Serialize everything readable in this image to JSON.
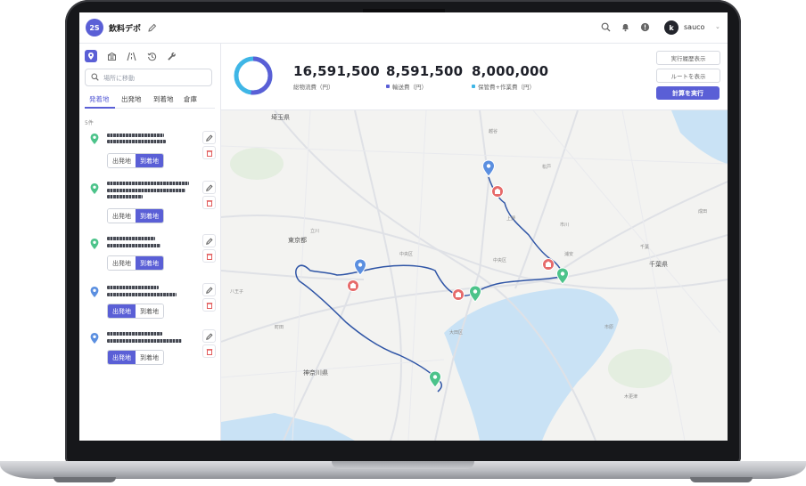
{
  "workspace": {
    "initials": "2S",
    "name": "飲料デポ"
  },
  "user": {
    "initial": "k",
    "name": "sauco"
  },
  "sidebar": {
    "search_placeholder": "場所に移動",
    "tabs": [
      "発着地",
      "出発地",
      "到着地",
      "倉庫"
    ],
    "active_tab": "発着地",
    "count": "5件",
    "locations": [
      {
        "pin_color": "#4cc38a",
        "mode": "到着地"
      },
      {
        "pin_color": "#4cc38a",
        "mode": "到着地"
      },
      {
        "pin_color": "#4cc38a",
        "mode": "到着地"
      },
      {
        "pin_color": "#5b8fe0",
        "mode": "出発地"
      },
      {
        "pin_color": "#5b8fe0",
        "mode": "出発地"
      }
    ],
    "mode_labels": {
      "departure": "出発地",
      "arrival": "到着地"
    }
  },
  "summary": {
    "total_value": "16,591,500",
    "total_label": "総物流費（円）",
    "transport_value": "8,591,500",
    "transport_label": "輸送費（円）",
    "storage_value": "8,000,000",
    "storage_label": "保管費+作業費（円）",
    "donut_split": 0.52,
    "colors": {
      "transport": "#5a5fd6",
      "storage": "#3fb6e6",
      "accent": "#5a5fd6"
    }
  },
  "actions": {
    "history_label": "実行履歴表示",
    "route_label": "ルートを表示",
    "run_label": "計算を実行"
  },
  "map": {
    "labels": [
      "埼玉県",
      "東京都",
      "神奈川県",
      "千葉県",
      "中央区",
      "大田区",
      "中央区",
      "上野",
      "浦安",
      "千葉",
      "成田",
      "市原",
      "木更津",
      "市川",
      "松戸",
      "越谷",
      "八王子",
      "立川",
      "町田"
    ]
  }
}
